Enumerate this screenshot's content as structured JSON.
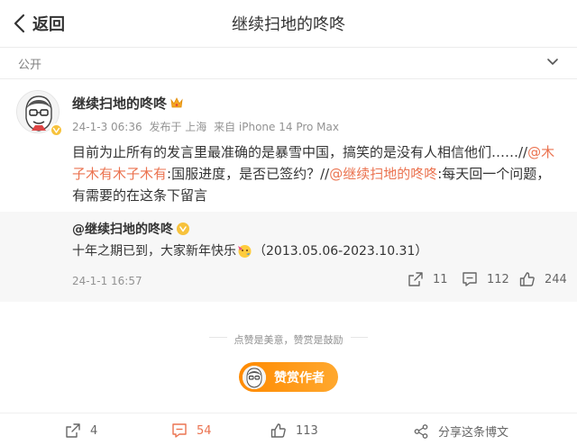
{
  "header": {
    "back_label": "返回",
    "title": "继续扫地的咚咚"
  },
  "visibility": {
    "label": "公开"
  },
  "post": {
    "author": "继续扫地的咚咚",
    "date": "24-1-3 06:36",
    "location": "发布于 上海",
    "source": "来自 iPhone 14 Pro Max",
    "text_parts": {
      "p1": "目前为止所有的发言里最准确的是暴雪中国，搞笑的是没有人相信他们……//",
      "m1": "@木子木有木子木有",
      "p2": ":国服进度，是否已签约？//",
      "m2": "@继续扫地的咚咚",
      "p3": ":每天回一个问题，有需要的在这条下留言"
    }
  },
  "repost": {
    "author": "@继续扫地的咚咚",
    "text_a": "十年之期已到，大家新年快乐",
    "text_b": "（2013.05.06-2023.10.31）",
    "date": "24-1-1 16:57",
    "shares": "11",
    "comments": "112",
    "likes": "244"
  },
  "reward": {
    "tip": "点赞是美意，赞赏是鼓励",
    "button_label": "赞赏作者"
  },
  "bottom_bar": {
    "shares": "4",
    "comments": "54",
    "likes": "113",
    "share_label": "分享这条博文"
  },
  "colors": {
    "accent": "#eb7350",
    "verified": "#f7c23c",
    "reward": "#ff9500"
  }
}
